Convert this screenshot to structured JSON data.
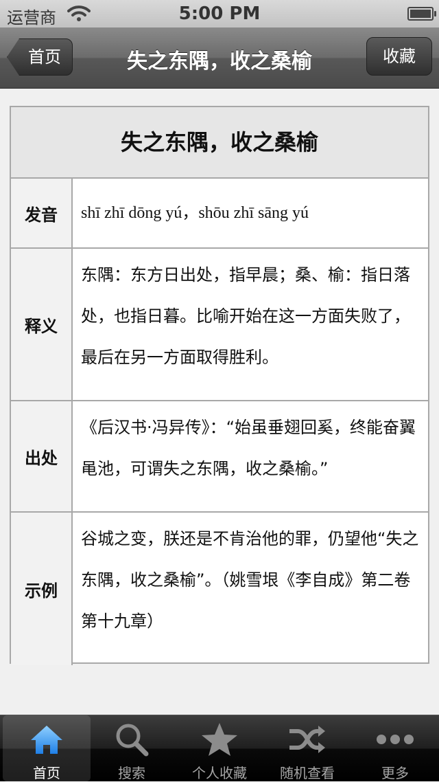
{
  "status_bar": {
    "carrier": "运营商",
    "time": "5:00 PM"
  },
  "nav": {
    "back_label": "首页",
    "title": "失之东隅，收之桑榆",
    "favorite_label": "收藏"
  },
  "idiom": {
    "title": "失之东隅，收之桑榆",
    "rows": [
      {
        "label": "发音",
        "value": "shī zhī dōng yú，shōu zhī sāng yú"
      },
      {
        "label": "释义",
        "value": "东隅：东方日出处，指早晨；桑、榆：指日落处，也指日暮。比喻开始在这一方面失败了，最后在另一方面取得胜利。"
      },
      {
        "label": "出处",
        "value": "《后汉书·冯异传》：“始虽垂翅回奚，终能奋翼黾池，可谓失之东隅，收之桑榆。”"
      },
      {
        "label": "示例",
        "value": "谷城之变，朕还是不肯治他的罪，仍望他“失之东隅，收之桑榆”。（姚雪垠《李自成》第二卷第十九章）"
      }
    ]
  },
  "tabs": [
    {
      "label": "首页",
      "icon": "home-icon",
      "active": true
    },
    {
      "label": "搜索",
      "icon": "search-icon"
    },
    {
      "label": "个人收藏",
      "icon": "star-icon"
    },
    {
      "label": "随机查看",
      "icon": "shuffle-icon"
    },
    {
      "label": "更多",
      "icon": "more-icon"
    }
  ],
  "colors": {
    "active_tab_icon": "#2f8cff",
    "inactive_tab": "#a6a6a6"
  }
}
